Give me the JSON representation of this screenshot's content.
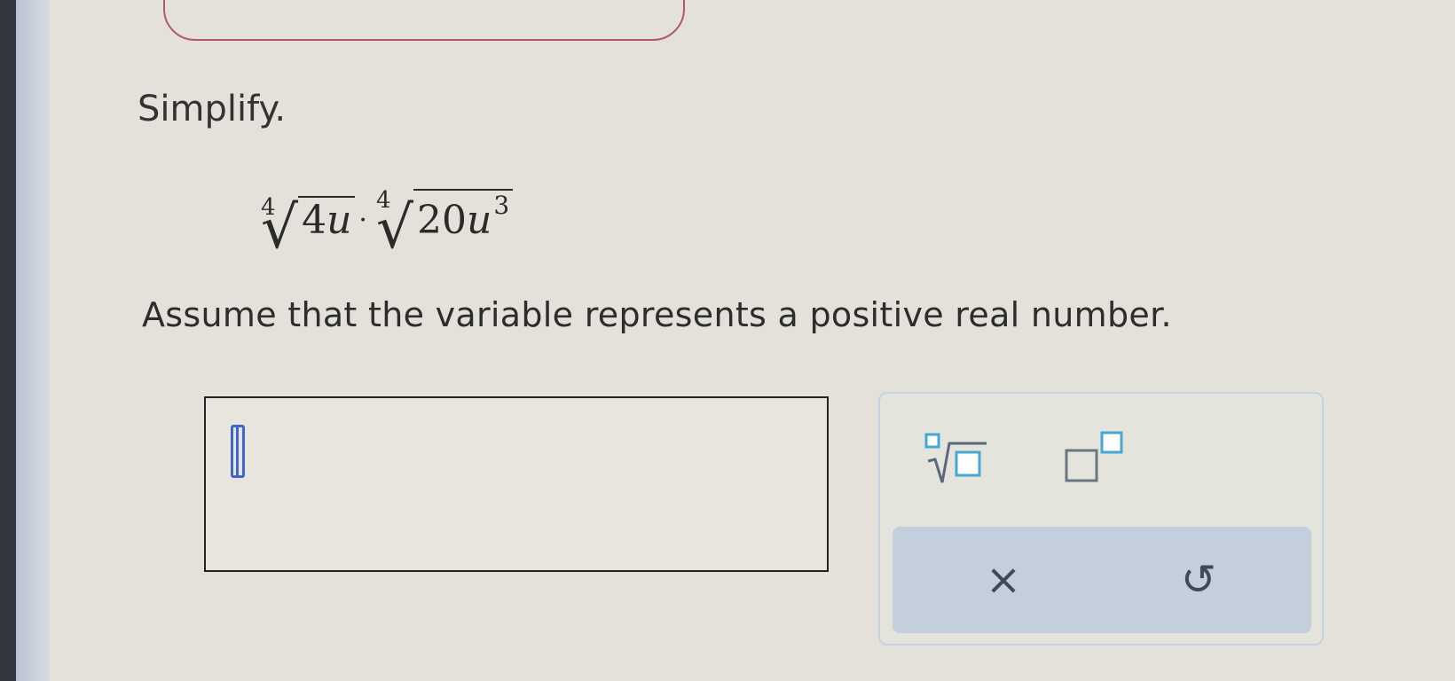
{
  "question": {
    "prompt": "Simplify.",
    "expression": {
      "term1": {
        "index": "4",
        "coefficient": "4",
        "variable": "u"
      },
      "operator": "·",
      "term2": {
        "index": "4",
        "coefficient": "20",
        "variable": "u",
        "exponent": "3"
      }
    },
    "instruction": "Assume that the variable represents a positive real number."
  },
  "answer": {
    "value": ""
  },
  "toolbox": {
    "buttons": [
      {
        "icon": "nth-root-icon"
      },
      {
        "icon": "superscript-icon"
      }
    ],
    "actions": {
      "clear_label": "×",
      "undo_label": "↺"
    }
  },
  "colors": {
    "background": "#e3e1d9",
    "caret": "#3f66c9",
    "placeholder": "#46a8d2",
    "action_bar": "#c3cfdc",
    "top_frame_border": "#b25a64"
  }
}
